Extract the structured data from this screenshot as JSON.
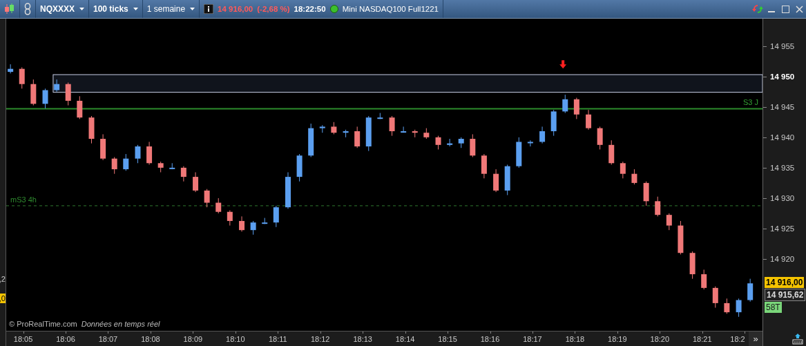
{
  "toolbar": {
    "instrument": "NQXXXX",
    "interval": "100 ticks",
    "period": "1 semaine",
    "price": "14 916,00",
    "change": "(-2,68 %)",
    "time": "18:22:50",
    "connected": true,
    "title": "Mini NASDAQ100 Full1221"
  },
  "left_edge": [
    {
      "text": ",2",
      "kind": "plain"
    },
    {
      "text": ",0",
      "kind": "highlight"
    }
  ],
  "chart": {
    "chart_data": {
      "type": "candlestick",
      "x": [
        1084.7,
        1084.97,
        1085.24,
        1085.52,
        1085.79,
        1086.06,
        1086.33,
        1086.61,
        1086.88,
        1087.15,
        1087.42,
        1087.7,
        1087.97,
        1088.24,
        1088.51,
        1088.78,
        1089.06,
        1089.33,
        1089.6,
        1089.87,
        1090.15,
        1090.42,
        1090.69,
        1090.96,
        1091.24,
        1091.51,
        1091.78,
        1092.05,
        1092.32,
        1092.6,
        1092.87,
        1093.14,
        1093.41,
        1093.69,
        1093.96,
        1094.23,
        1094.5,
        1094.78,
        1095.05,
        1095.32,
        1095.59,
        1095.86,
        1096.14,
        1096.41,
        1096.68,
        1096.95,
        1097.23,
        1097.5,
        1097.77,
        1098.04,
        1098.32,
        1098.59,
        1098.86,
        1099.13,
        1099.4,
        1099.68,
        1099.95,
        1100.22,
        1100.49,
        1100.77,
        1101.04,
        1101.31,
        1101.58,
        1101.86,
        1102.13
      ],
      "ohlc": [
        [
          14950.75,
          14952,
          14950.5,
          14951.25
        ],
        [
          14951.25,
          14951.5,
          14948,
          14948.75
        ],
        [
          14948.75,
          14949.5,
          14945.25,
          14945.5
        ],
        [
          14945.5,
          14948,
          14944.75,
          14947.75
        ],
        [
          14947.75,
          14949.5,
          14947.5,
          14948.75
        ],
        [
          14948.75,
          14949,
          14945.25,
          14946
        ],
        [
          14946,
          14946.75,
          14943,
          14943.25
        ],
        [
          14943.25,
          14943.5,
          14939,
          14939.75
        ],
        [
          14939.75,
          14940.5,
          14936.25,
          14936.5
        ],
        [
          14936.5,
          14936.75,
          14934,
          14934.75
        ],
        [
          14934.75,
          14937.25,
          14934.5,
          14936.5
        ],
        [
          14936.5,
          14938.75,
          14935.75,
          14938.5
        ],
        [
          14938.5,
          14939.25,
          14935.5,
          14935.75
        ],
        [
          14935.75,
          14936,
          14934.25,
          14935
        ],
        [
          14935,
          14935.75,
          14934.75,
          14935
        ],
        [
          14935,
          14935.25,
          14932.75,
          14933.5
        ],
        [
          14933.5,
          14934.25,
          14931,
          14931.25
        ],
        [
          14931.25,
          14931.5,
          14928.5,
          14929.25
        ],
        [
          14929.25,
          14930,
          14927.5,
          14927.75
        ],
        [
          14927.75,
          14928,
          14925.5,
          14926.25
        ],
        [
          14926.25,
          14927,
          14924.5,
          14924.75
        ],
        [
          14924.75,
          14926.25,
          14924,
          14926
        ],
        [
          14926,
          14926.75,
          14925.75,
          14926
        ],
        [
          14926,
          14928.75,
          14925.25,
          14928.5
        ],
        [
          14928.5,
          14934.25,
          14928.25,
          14933.5
        ],
        [
          14933.5,
          14937.25,
          14932.75,
          14937
        ],
        [
          14937,
          14942.25,
          14936.75,
          14941.5
        ],
        [
          14941.5,
          14942,
          14940.75,
          14941.75
        ],
        [
          14941.75,
          14942.5,
          14940.5,
          14940.75
        ],
        [
          14940.75,
          14941.25,
          14940,
          14941
        ],
        [
          14941,
          14941.75,
          14938.25,
          14938.5
        ],
        [
          14938.5,
          14943.5,
          14937.75,
          14943.25
        ],
        [
          14943.25,
          14944,
          14943,
          14943.25
        ],
        [
          14943.25,
          14943.5,
          14940.25,
          14941
        ],
        [
          14941,
          14941.75,
          14940.75,
          14941
        ],
        [
          14941,
          14941.25,
          14940,
          14940.75
        ],
        [
          14940.75,
          14941.5,
          14939.75,
          14940
        ],
        [
          14940,
          14940.25,
          14938,
          14938.75
        ],
        [
          14938.75,
          14939.75,
          14938.5,
          14939
        ],
        [
          14939,
          14940,
          14938.25,
          14939.75
        ],
        [
          14939.75,
          14940.5,
          14936.75,
          14937
        ],
        [
          14937,
          14937.25,
          14933.25,
          14934
        ],
        [
          14934,
          14934.75,
          14931,
          14931.25
        ],
        [
          14931.25,
          14935.5,
          14930.5,
          14935.25
        ],
        [
          14935.25,
          14940,
          14935,
          14939.25
        ],
        [
          14939.25,
          14939.5,
          14938.5,
          14939.25
        ],
        [
          14939.25,
          14941.75,
          14939,
          14941
        ],
        [
          14941,
          14944.5,
          14940.25,
          14944.25
        ],
        [
          14944.25,
          14947,
          14944,
          14946.25
        ],
        [
          14946.25,
          14946.5,
          14943,
          14943.75
        ],
        [
          14943.75,
          14944.5,
          14941.25,
          14941.5
        ],
        [
          14941.5,
          14941.75,
          14938,
          14938.75
        ],
        [
          14938.75,
          14939.5,
          14935.5,
          14935.75
        ],
        [
          14935.75,
          14936,
          14933.25,
          14934
        ],
        [
          14934,
          14934.75,
          14932.25,
          14932.5
        ],
        [
          14932.5,
          14932.75,
          14928.75,
          14929.5
        ],
        [
          14929.5,
          14930.25,
          14927,
          14927.25
        ],
        [
          14927.25,
          14927.5,
          14924.75,
          14925.5
        ],
        [
          14925.5,
          14926.25,
          14920.75,
          14921
        ],
        [
          14921,
          14921.25,
          14916.75,
          14917.5
        ],
        [
          14917.5,
          14918.25,
          14915,
          14915.25
        ],
        [
          14915.25,
          14915.5,
          14912,
          14912.75
        ],
        [
          14912.75,
          14913.5,
          14911,
          14911.25
        ],
        [
          14911.25,
          14913.5,
          14910.5,
          14913.25
        ],
        [
          14913.25,
          14916.75,
          14913,
          14916
        ]
      ],
      "ylim": [
        14908.2,
        14959.5
      ],
      "yticks": [
        {
          "value": 14955,
          "label": "14 955"
        },
        {
          "value": 14950,
          "label": "14 950"
        },
        {
          "value": 14945,
          "label": "14 945"
        },
        {
          "value": 14940,
          "label": "14 940"
        },
        {
          "value": 14935,
          "label": "14 935"
        },
        {
          "value": 14930,
          "label": "14 930"
        },
        {
          "value": 14925,
          "label": "14 925"
        },
        {
          "value": 14920,
          "label": "14 920"
        }
      ],
      "xticks": [
        {
          "value": 1085,
          "label": "18:05"
        },
        {
          "value": 1086,
          "label": "18:06"
        },
        {
          "value": 1087,
          "label": "18:07"
        },
        {
          "value": 1088,
          "label": "18:08"
        },
        {
          "value": 1089,
          "label": "18:09"
        },
        {
          "value": 1090,
          "label": "18:10"
        },
        {
          "value": 1091,
          "label": "18:11"
        },
        {
          "value": 1092,
          "label": "18:12"
        },
        {
          "value": 1093,
          "label": "18:13"
        },
        {
          "value": 1094,
          "label": "18:14"
        },
        {
          "value": 1095,
          "label": "18:15"
        },
        {
          "value": 1096,
          "label": "18:16"
        },
        {
          "value": 1097,
          "label": "18:17"
        },
        {
          "value": 1098,
          "label": "18:18"
        },
        {
          "value": 1099,
          "label": "18:19"
        },
        {
          "value": 1100,
          "label": "18:20"
        },
        {
          "value": 1101,
          "label": "18:21"
        },
        {
          "value": 1102,
          "label": "18:2"
        }
      ],
      "xlim": [
        1084.6,
        1102.42
      ],
      "ref_lines": [
        {
          "axis": "y",
          "value": 14944.7,
          "label": "S3 J"
        },
        {
          "axis": "y",
          "value": 14928.75,
          "label": "mS3 4h"
        }
      ],
      "bands": [
        {
          "axis": "y",
          "from": 14947.4,
          "to": 14950.3
        }
      ]
    },
    "credit": "© ProRealTime.com",
    "realtime": "Données en temps réel",
    "scroll_button": "»",
    "price_tags": [
      {
        "text": "14 916,00",
        "kind": "last"
      },
      {
        "text": "14 915,62",
        "kind": "mid"
      },
      {
        "text": "58T",
        "kind": "ticks"
      }
    ]
  }
}
